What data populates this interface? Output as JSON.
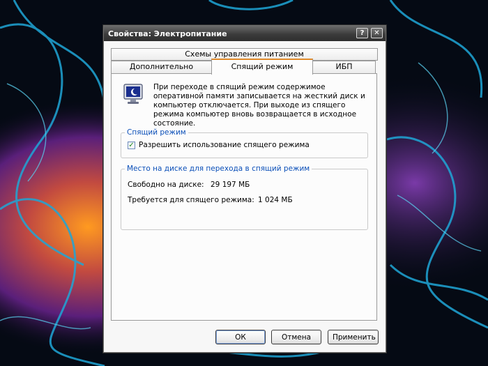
{
  "window": {
    "title": "Свойства: Электропитание",
    "help_glyph": "?",
    "close_glyph": "✕"
  },
  "tabs": {
    "row1": [
      "Схемы управления питанием"
    ],
    "row2": [
      "Дополнительно",
      "Спящий режим",
      "ИБП"
    ],
    "active": "Спящий режим"
  },
  "hibernate": {
    "description": "При переходе в спящий режим содержимое оперативной памяти записывается на жесткий диск и компьютер отключается. При выходе из спящего режима компьютер вновь возвращается в исходное состояние.",
    "group_title": "Спящий режим",
    "enable_label": "Разрешить использование спящего режима",
    "enable_checked": true,
    "check_glyph": "✓"
  },
  "disk": {
    "group_title": "Место на диске для перехода в спящий режим",
    "free_label": "Свободно на диске:",
    "free_value": "29 197 МБ",
    "required_label": "Требуется для спящего режима:",
    "required_value": "1 024 МБ"
  },
  "buttons": {
    "ok": "ОК",
    "cancel": "Отмена",
    "apply": "Применить"
  },
  "icons": {
    "help": "help-icon",
    "close": "close-icon",
    "monitor": "monitor-icon"
  },
  "colors": {
    "group_title": "#0b4fb8",
    "active_tab_accent": "#e08a2a",
    "titlebar": "#3c3c3c"
  }
}
